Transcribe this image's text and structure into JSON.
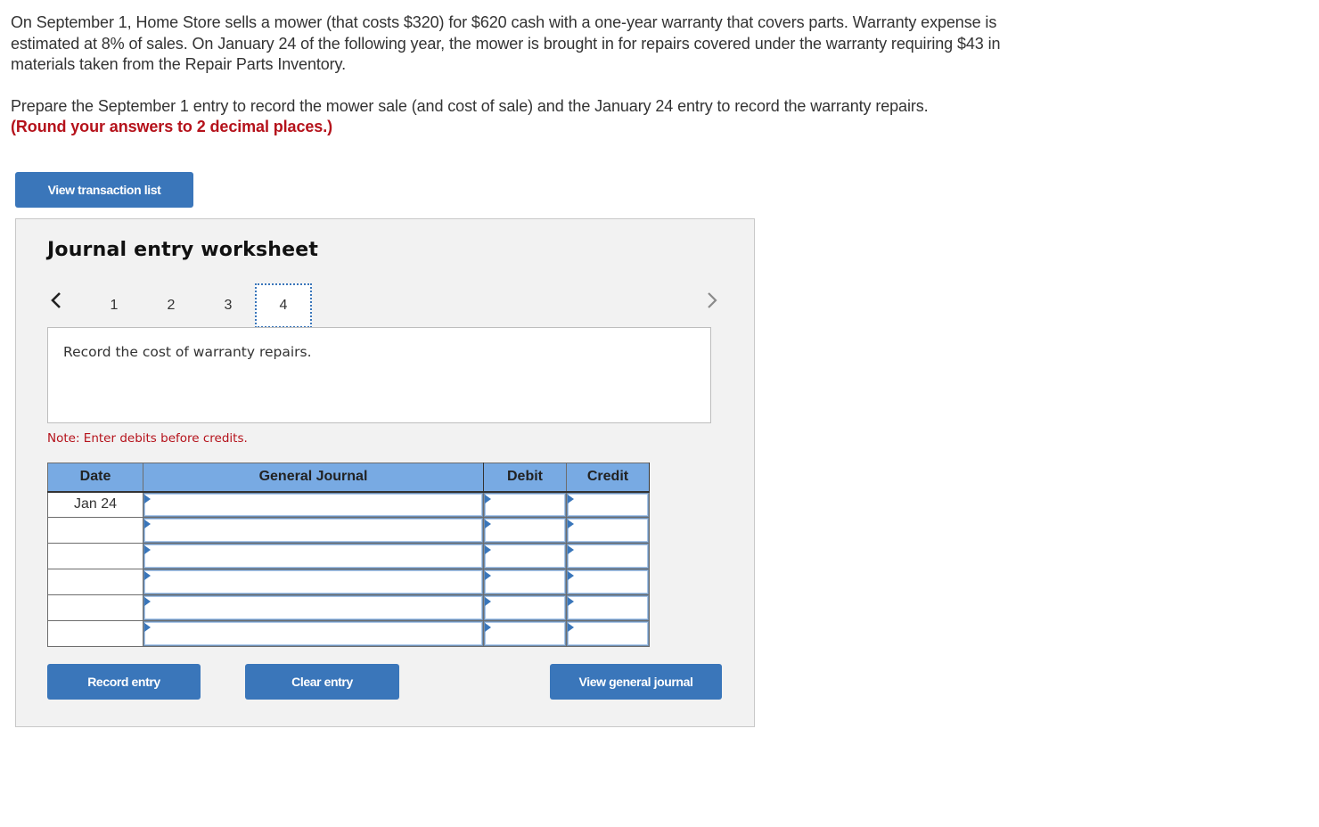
{
  "problem": {
    "paragraph1": "On September 1, Home Store sells a mower (that costs $320) for $620 cash with a one-year warranty that covers parts. Warranty expense is estimated at 8% of sales. On January 24 of the following year, the mower is brought in for repairs covered under the warranty requiring $43 in materials taken from the Repair Parts Inventory.",
    "paragraph2": "Prepare the September 1 entry to record the mower sale (and cost of sale) and the January 24 entry to record the warranty repairs.",
    "rounding_note": "(Round your answers to 2 decimal places.)"
  },
  "buttons": {
    "view_transaction_list": "View transaction list",
    "record_entry": "Record entry",
    "clear_entry": "Clear entry",
    "view_general_journal": "View general journal"
  },
  "worksheet": {
    "title": "Journal entry worksheet",
    "pager": {
      "prev_icon": "chevron-left-icon",
      "next_icon": "chevron-right-icon",
      "pages": [
        "1",
        "2",
        "3",
        "4"
      ],
      "active_page": "4"
    },
    "instruction": "Record the cost of warranty repairs.",
    "note": "Note: Enter debits before credits."
  },
  "journal": {
    "columns": [
      "Date",
      "General Journal",
      "Debit",
      "Credit"
    ],
    "rows": [
      {
        "date": "Jan 24",
        "account": "",
        "debit": "",
        "credit": ""
      },
      {
        "date": "",
        "account": "",
        "debit": "",
        "credit": ""
      },
      {
        "date": "",
        "account": "",
        "debit": "",
        "credit": ""
      },
      {
        "date": "",
        "account": "",
        "debit": "",
        "credit": ""
      },
      {
        "date": "",
        "account": "",
        "debit": "",
        "credit": ""
      },
      {
        "date": "",
        "account": "",
        "debit": "",
        "credit": ""
      }
    ]
  },
  "colors": {
    "button_blue": "#3a76ba",
    "header_blue": "#78aae3",
    "alert_red": "#b5121b",
    "panel_gray": "#f2f2f2"
  }
}
